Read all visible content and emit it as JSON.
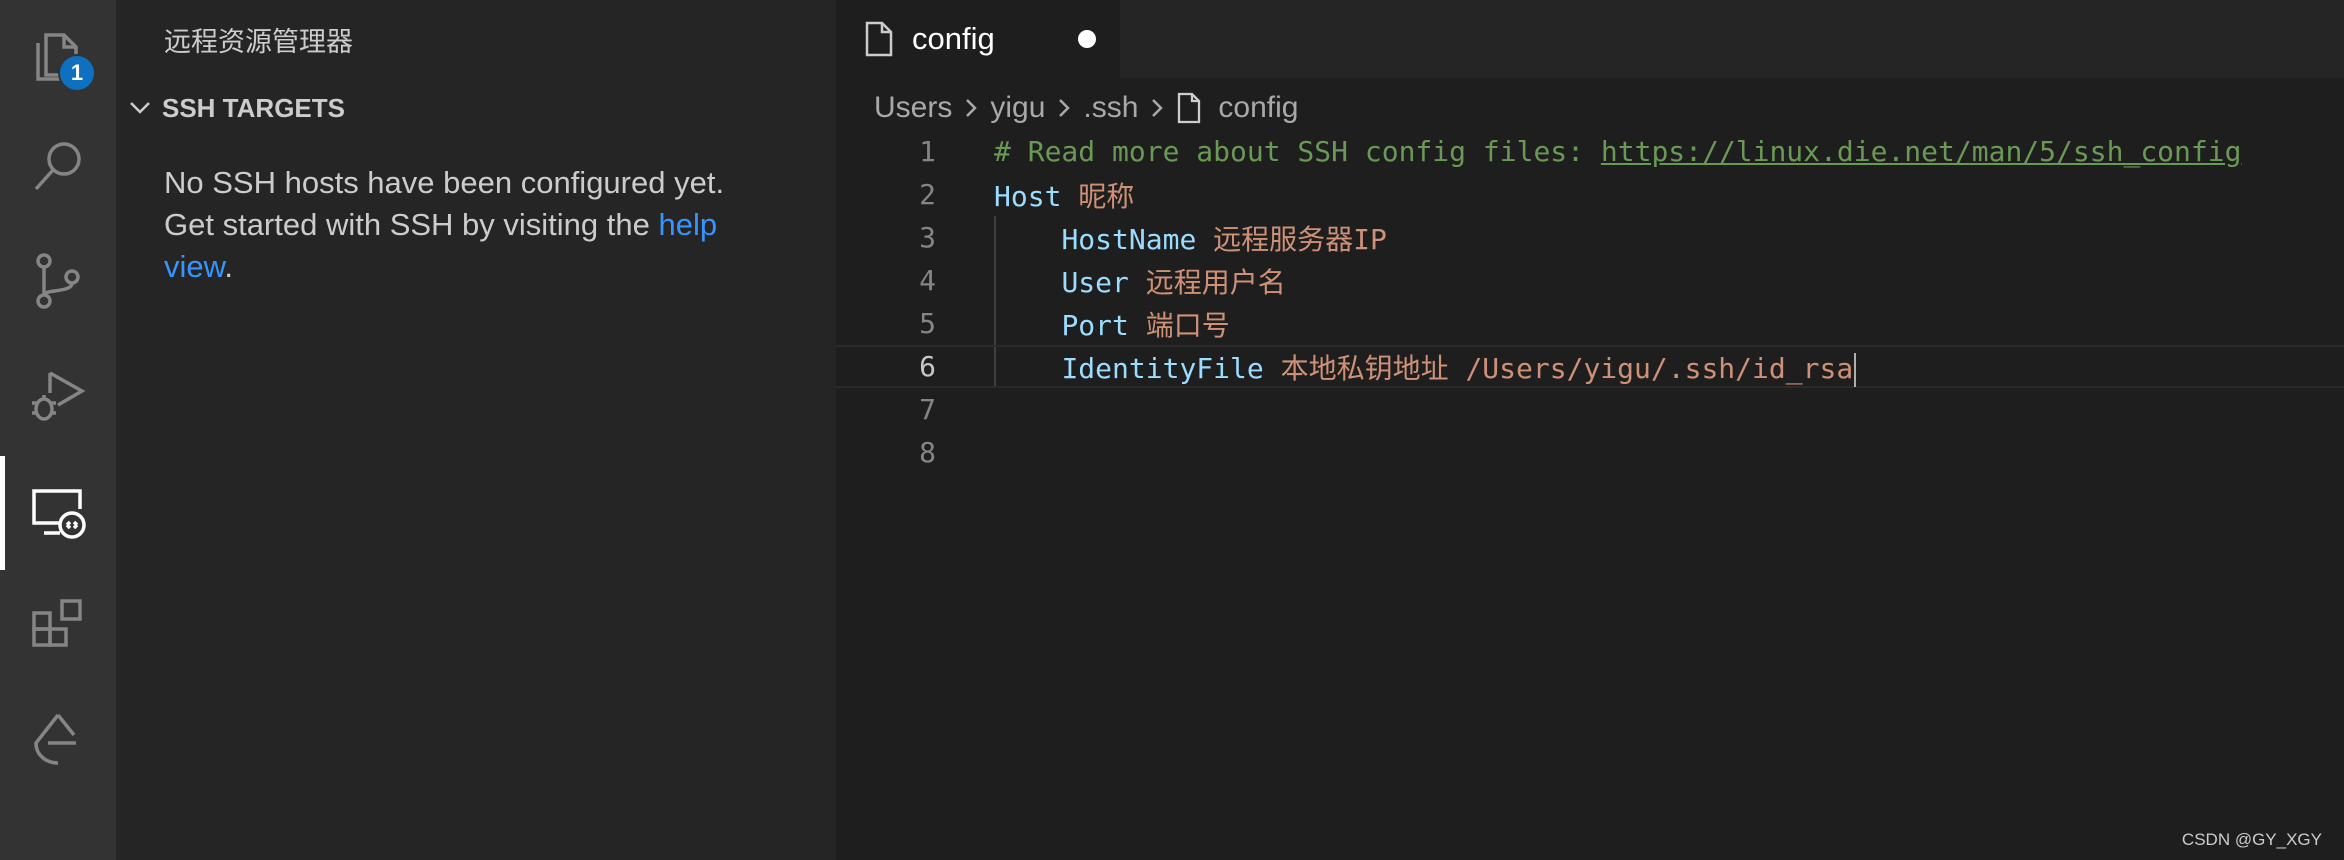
{
  "activity_bar": {
    "items": [
      {
        "name": "explorer-icon",
        "badge": "1"
      },
      {
        "name": "search-icon"
      },
      {
        "name": "source-control-icon"
      },
      {
        "name": "run-debug-icon"
      },
      {
        "name": "remote-explorer-icon"
      },
      {
        "name": "extensions-icon"
      },
      {
        "name": "gitlens-icon"
      }
    ],
    "active_item": "remote-explorer-icon"
  },
  "sidebar": {
    "title": "远程资源管理器",
    "section": {
      "label": "SSH TARGETS",
      "message_before": "No SSH hosts have been configured yet. Get started with SSH by visiting the ",
      "link_text": "help view",
      "message_after": "."
    }
  },
  "editor": {
    "tab": {
      "label": "config",
      "dirty": true
    },
    "breadcrumb": [
      "Users",
      "yigu",
      ".ssh",
      "config"
    ],
    "active_line": 6,
    "lines": [
      {
        "number": "1",
        "comment": "# Read more about SSH config files: ",
        "url": "https://linux.die.net/man/5/ssh_config"
      },
      {
        "number": "2",
        "key": "Host",
        "value": " 昵称"
      },
      {
        "number": "3",
        "indent": "    ",
        "key": "HostName",
        "value": " 远程服务器IP"
      },
      {
        "number": "4",
        "indent": "    ",
        "key": "User",
        "value": " 远程用户名"
      },
      {
        "number": "5",
        "indent": "    ",
        "key": "Port",
        "value": " 端口号"
      },
      {
        "number": "6",
        "indent": "    ",
        "key": "IdentityFile",
        "value": " 本地私钥地址 /Users/yigu/.ssh/id_rsa"
      },
      {
        "number": "7"
      },
      {
        "number": "8"
      }
    ]
  },
  "watermark": "CSDN @GY_XGY",
  "colors": {
    "accent": "#0e70c0",
    "link": "#3794ff",
    "comment": "#6a9955",
    "keyword": "#9cdcfe",
    "string": "#ce9178"
  }
}
